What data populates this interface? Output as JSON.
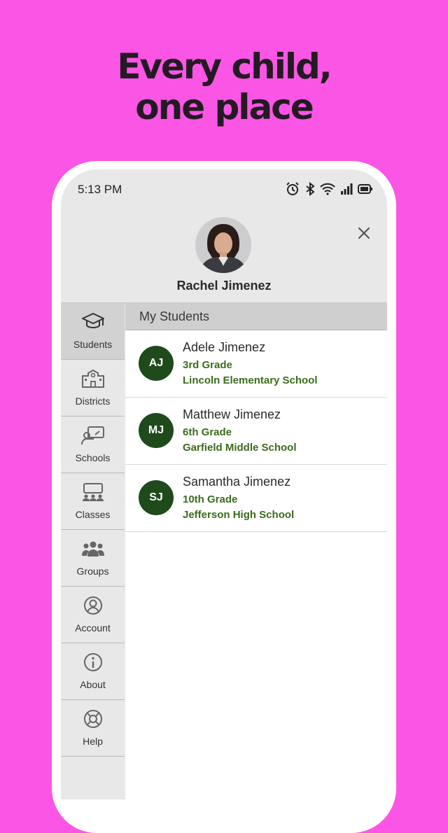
{
  "promo": {
    "headline_line1": "Every child,",
    "headline_line2": "one place",
    "background_color": "#fb55e6"
  },
  "status_bar": {
    "time": "5:13 PM",
    "icons": [
      "alarm-icon",
      "bluetooth-icon",
      "wifi-icon",
      "signal-icon",
      "battery-icon"
    ]
  },
  "profile": {
    "name": "Rachel Jimenez",
    "avatar": "profile-photo"
  },
  "sidebar": {
    "items": [
      {
        "label": "Students",
        "icon": "graduation-cap-icon",
        "active": true
      },
      {
        "label": "Districts",
        "icon": "school-building-icon",
        "active": false
      },
      {
        "label": "Schools",
        "icon": "teacher-board-icon",
        "active": false
      },
      {
        "label": "Classes",
        "icon": "classroom-icon",
        "active": false
      },
      {
        "label": "Groups",
        "icon": "group-icon",
        "active": false
      },
      {
        "label": "Account",
        "icon": "account-circle-icon",
        "active": false
      },
      {
        "label": "About",
        "icon": "info-icon",
        "active": false
      },
      {
        "label": "Help",
        "icon": "lifebuoy-icon",
        "active": false
      }
    ]
  },
  "main": {
    "section_title": "My Students",
    "students": [
      {
        "initials": "AJ",
        "name": "Adele Jimenez",
        "grade": "3rd Grade",
        "school": "Lincoln Elementary School"
      },
      {
        "initials": "MJ",
        "name": "Matthew Jimenez",
        "grade": "6th Grade",
        "school": "Garfield Middle School"
      },
      {
        "initials": "SJ",
        "name": "Samantha Jimenez",
        "grade": "10th Grade",
        "school": "Jefferson High School"
      }
    ]
  },
  "colors": {
    "accent_green": "#1f4a1c",
    "text_green": "#3a6d1c"
  }
}
